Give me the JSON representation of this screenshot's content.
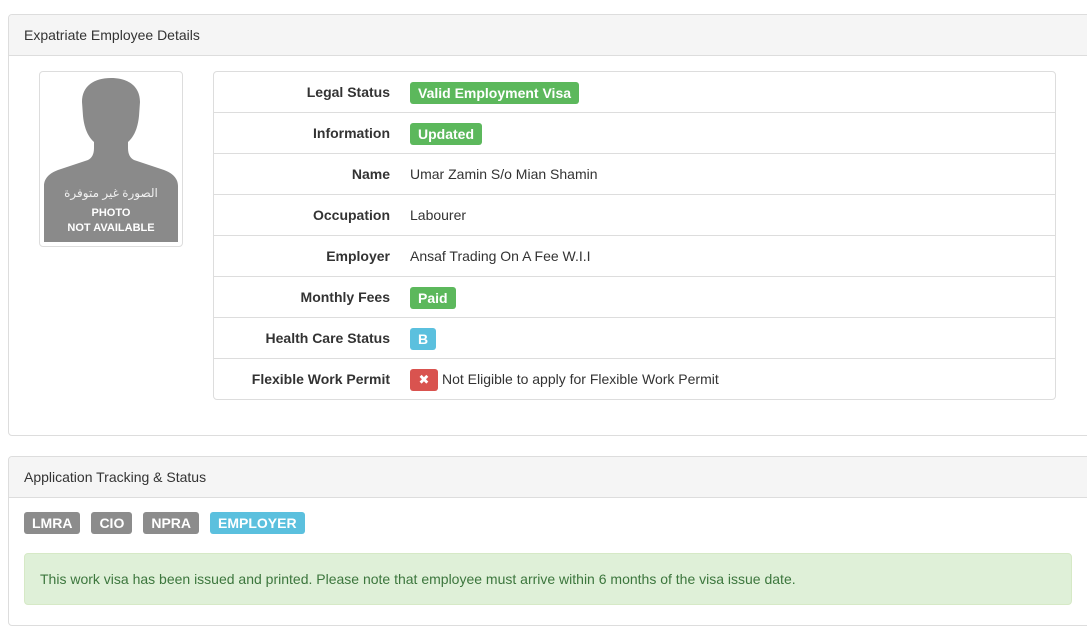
{
  "employee_panel": {
    "title": "Expatriate Employee Details",
    "photo": {
      "arabic_text": "الصورة غير متوفرة",
      "line1": "PHOTO",
      "line2": "NOT AVAILABLE"
    },
    "rows": [
      {
        "label": "Legal Status",
        "value": "Valid Employment Visa",
        "style": "label-success"
      },
      {
        "label": "Information",
        "value": "Updated",
        "style": "label-success"
      },
      {
        "label": "Name",
        "value": "Umar Zamin S/o Mian Shamin",
        "style": "text"
      },
      {
        "label": "Occupation",
        "value": "Labourer",
        "style": "text"
      },
      {
        "label": "Employer",
        "value": "Ansaf Trading On A Fee W.I.I",
        "style": "text"
      },
      {
        "label": "Monthly Fees",
        "value": "Paid",
        "style": "label-success"
      },
      {
        "label": "Health Care Status",
        "value": "B",
        "style": "label-info"
      },
      {
        "label": "Flexible Work Permit",
        "value": "Not Eligible to apply for Flexible Work Permit",
        "icon": "close-icon",
        "icon_glyph": "✖",
        "style": "icon-text"
      }
    ]
  },
  "tracking_panel": {
    "title": "Application Tracking & Status",
    "stages": [
      {
        "label": "LMRA",
        "color": "#8c8c8c",
        "active": false
      },
      {
        "label": "CIO",
        "color": "#8c8c8c",
        "active": false
      },
      {
        "label": "NPRA",
        "color": "#8c8c8c",
        "active": false
      },
      {
        "label": "EMPLOYER",
        "color": "#5bc0de",
        "active": true
      }
    ],
    "alert": "This work visa has been issued and printed. Please note that employee must arrive within 6 months of the visa issue date."
  },
  "colors": {
    "success": "#5cb85c",
    "info": "#5bc0de",
    "danger": "#d9534f",
    "default": "#8c8c8c",
    "alert_bg": "#dff0d8",
    "alert_text": "#3c763d"
  }
}
